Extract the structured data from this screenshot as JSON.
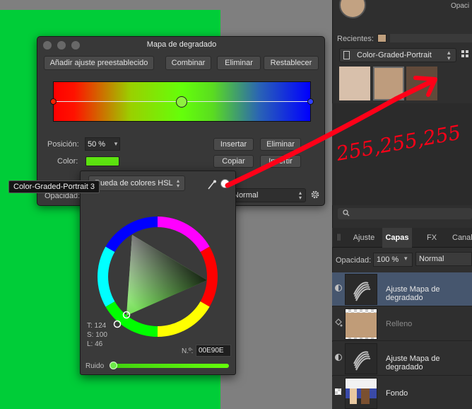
{
  "gradient_map": {
    "title": "Mapa de degradado",
    "buttons": {
      "add_preset": "Añadir ajuste preestablecido",
      "combine": "Combinar",
      "delete": "Eliminar",
      "reset": "Restablecer"
    },
    "position_label": "Posición:",
    "position_value": "50 %",
    "color_label": "Color:",
    "color_value": "#5de310",
    "stop_buttons": {
      "insert": "Insertar",
      "delete": "Eliminar",
      "copy": "Copiar",
      "invert": "Invertir"
    },
    "opacity_label": "Opacidad:",
    "blend_mode": "Normal"
  },
  "tooltip": {
    "text": "Color-Graded-Portrait 3"
  },
  "color_popup": {
    "model_select": "Rueda de colores HSL",
    "hsl": {
      "t": "T: 124",
      "s": "S: 100",
      "l": "L: 46"
    },
    "hex_label": "N.º:",
    "hex_value": "00E90E",
    "noise_label": "Ruido"
  },
  "swatches_panel": {
    "opacity_label": "Opaci",
    "recent_label": "Recientes:",
    "recent_color": "#c0a07e",
    "palette_name": "Color-Graded-Portrait",
    "swatches": [
      "#d8c0ab",
      "#be9c7d",
      "#614a3a"
    ]
  },
  "layers_panel": {
    "tabs": [
      "Ajuste",
      "Capas",
      "FX",
      "Canal"
    ],
    "active_tab": "Capas",
    "opacity_label": "Opacidad:",
    "opacity_value": "100 %",
    "blend_mode": "Normal",
    "layers": [
      {
        "name": "Ajuste Mapa de degradado",
        "selected": true
      },
      {
        "name": "Relleno",
        "selected": false
      },
      {
        "name": "Ajuste Mapa de degradado",
        "selected": false
      },
      {
        "name": "Fondo",
        "selected": false
      }
    ]
  },
  "annotation": {
    "text": "255,255,255",
    "color": "#ff0018"
  }
}
